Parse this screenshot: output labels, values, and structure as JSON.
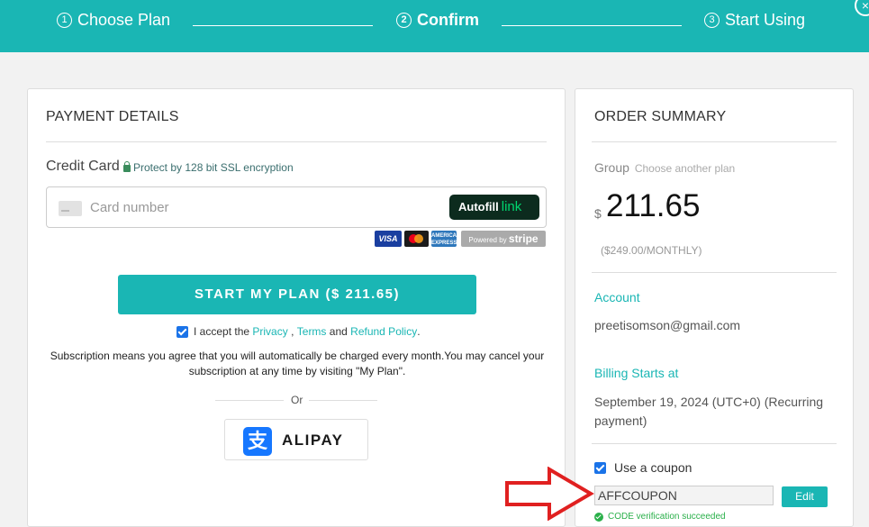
{
  "header": {
    "steps": [
      {
        "num": "1",
        "label": "Choose Plan"
      },
      {
        "num": "2",
        "label": "Confirm"
      },
      {
        "num": "3",
        "label": "Start Using"
      }
    ],
    "close": "×"
  },
  "payment": {
    "title": "PAYMENT DETAILS",
    "credit_card_label": "Credit Card",
    "ssl_text": "Protect by 128 bit SSL encryption",
    "card_placeholder": "Card number",
    "autofill_label": "Autofill",
    "autofill_link": "link",
    "brands": {
      "visa": "VISA",
      "amex": "AMERICAN EXPRESS",
      "stripe_prefix": "Powered by",
      "stripe_name": "stripe"
    },
    "start_button": "START MY PLAN ($ 211.65)",
    "accept": {
      "prefix": "I accept the",
      "privacy": "Privacy",
      "comma": ",",
      "terms": "Terms",
      "and": "and",
      "refund": "Refund Policy",
      "dot": "."
    },
    "subscription_text": "Subscription means you agree that you will automatically be charged every month.You may cancel your subscription at any time by visiting \"My Plan\".",
    "or": "Or",
    "alipay_logo": "支",
    "alipay_label": "ALIPAY"
  },
  "order": {
    "title": "ORDER SUMMARY",
    "group_label": "Group",
    "choose_plan_link": "Choose another plan",
    "currency": "$",
    "price": "211.65",
    "monthly": "($249.00/MONTHLY)",
    "account_label": "Account",
    "account_value": "preetisomson@gmail.com",
    "billing_label": "Billing Starts at",
    "billing_value": "September 19, 2024 (UTC+0) (Recurring payment)",
    "coupon_label": "Use a coupon",
    "coupon_checked": true,
    "coupon_code": "AFFCOUPON",
    "edit_button": "Edit",
    "verify_text": "CODE verification succeeded"
  },
  "colors": {
    "accent": "#1ab6b4",
    "annotation_arrow": "#e02020",
    "success": "#2ab04a"
  }
}
